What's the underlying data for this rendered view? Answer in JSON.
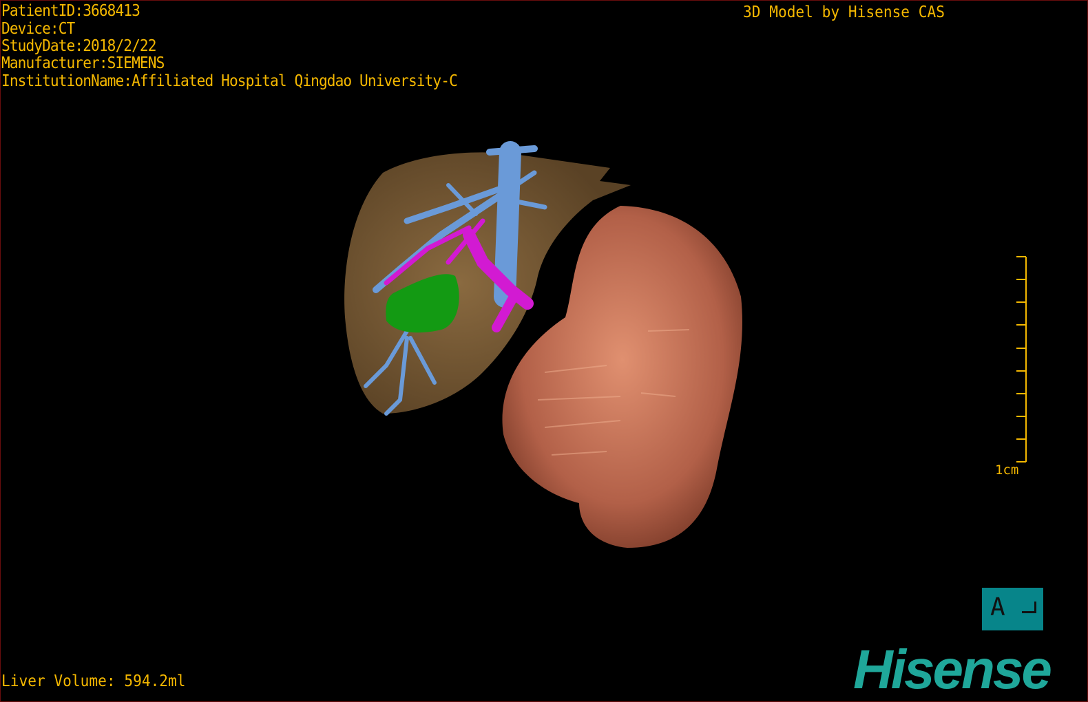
{
  "overlay": {
    "patient_id": "PatientID:3668413",
    "device": "Device:CT",
    "study_date": "StudyDate:2018/2/22",
    "manufacturer": "Manufacturer:SIEMENS",
    "institution": "InstitutionName:Affiliated Hospital Qingdao University-C",
    "credit": "3D Model by Hisense CAS",
    "liver_volume": "Liver Volume: 594.2ml"
  },
  "scale_bar": {
    "label": "1cm",
    "color": "#f5b800"
  },
  "orientation_cube": {
    "label": "A",
    "color": "#07858a"
  },
  "logo": {
    "text": "Hisense",
    "color": "#1fa79a"
  },
  "colors": {
    "liver": "#7a5a35",
    "portal_vein": "#6a9ad8",
    "artery": "#d21ad2",
    "gallbladder": "#139a13",
    "kidney": "#c87058",
    "text": "#f5b800"
  }
}
